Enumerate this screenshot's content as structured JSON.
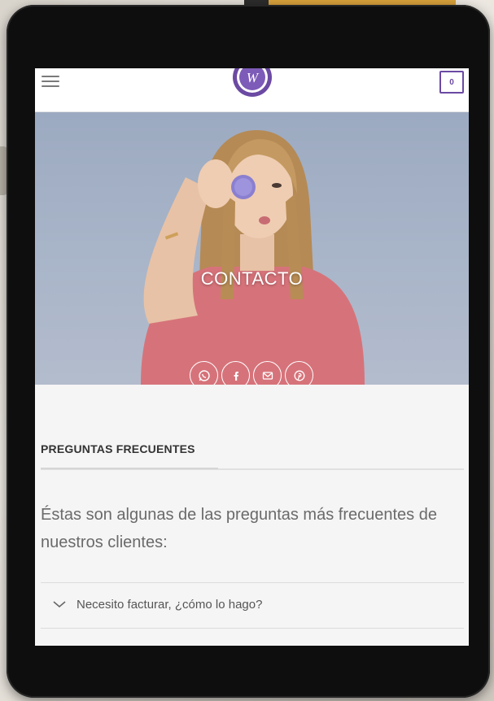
{
  "header": {
    "logo_letter": "W",
    "cart_count": "0"
  },
  "hero": {
    "title": "CONTACTO",
    "socials": [
      {
        "icon": "whatsapp-icon"
      },
      {
        "icon": "facebook-icon"
      },
      {
        "icon": "email-icon"
      },
      {
        "icon": "pinterest-icon"
      }
    ]
  },
  "faq": {
    "heading": "PREGUNTAS FRECUENTES",
    "intro": "Éstas son algunas de las preguntas más frecuentes de nuestros clientes:",
    "items": [
      {
        "question": "Necesito facturar, ¿cómo lo hago?"
      },
      {
        "question": ""
      }
    ]
  },
  "colors": {
    "brand_purple": "#6b4aa3",
    "hero_bg": "#a8b4c8",
    "shirt": "#d6737a"
  }
}
